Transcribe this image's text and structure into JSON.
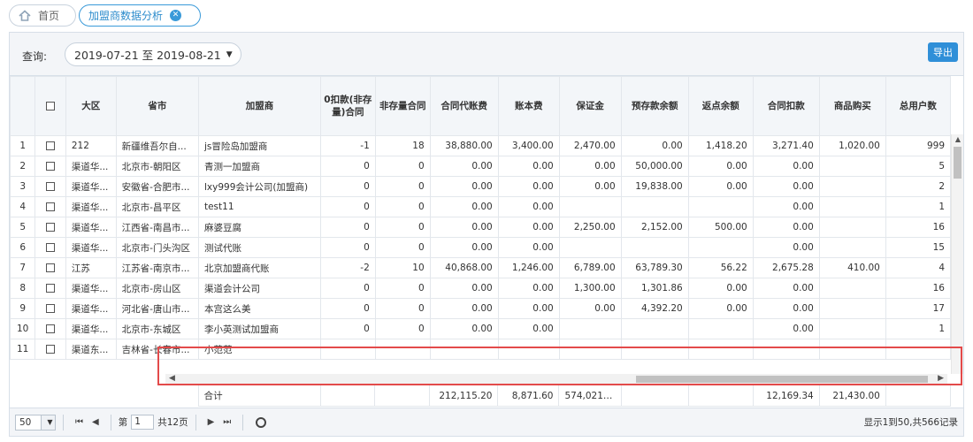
{
  "tabs": {
    "home_label": "首页",
    "active_label": "加盟商数据分析"
  },
  "query": {
    "label": "查询:",
    "date_range": "2019-07-21 至 2019-08-21",
    "export_label": "导出"
  },
  "table": {
    "headers": [
      "",
      "大区",
      "省市",
      "加盟商",
      "0扣款(非存量)合同",
      "非存量合同",
      "合同代账费",
      "账本费",
      "保证金",
      "预存款余额",
      "返点余额",
      "合同扣款",
      "商品购买",
      "总用户数"
    ],
    "rows": [
      [
        "1",
        "212",
        "新疆维吾尔自...",
        "js冒险岛加盟商",
        "-1",
        "18",
        "38,880.00",
        "3,400.00",
        "2,470.00",
        "0.00",
        "1,418.20",
        "3,271.40",
        "1,020.00",
        "999"
      ],
      [
        "2",
        "渠道华...",
        "北京市-朝阳区",
        "青测一加盟商",
        "0",
        "0",
        "0.00",
        "0.00",
        "0.00",
        "50,000.00",
        "0.00",
        "0.00",
        "",
        "5"
      ],
      [
        "3",
        "渠道华...",
        "安徽省-合肥市...",
        "lxy999会计公司(加盟商)",
        "0",
        "0",
        "0.00",
        "0.00",
        "0.00",
        "19,838.00",
        "0.00",
        "0.00",
        "",
        "2"
      ],
      [
        "4",
        "渠道华...",
        "北京市-昌平区",
        "test11",
        "0",
        "0",
        "0.00",
        "0.00",
        "",
        "",
        "",
        "0.00",
        "",
        "1"
      ],
      [
        "5",
        "渠道华...",
        "江西省-南昌市...",
        "麻婆豆腐",
        "0",
        "0",
        "0.00",
        "0.00",
        "2,250.00",
        "2,152.00",
        "500.00",
        "0.00",
        "",
        "16"
      ],
      [
        "6",
        "渠道华...",
        "北京市-门头沟区",
        "测试代账",
        "0",
        "0",
        "0.00",
        "0.00",
        "",
        "",
        "",
        "0.00",
        "",
        "15"
      ],
      [
        "7",
        "江苏",
        "江苏省-南京市...",
        "北京加盟商代账",
        "-2",
        "10",
        "40,868.00",
        "1,246.00",
        "6,789.00",
        "63,789.30",
        "56.22",
        "2,675.28",
        "410.00",
        "4"
      ],
      [
        "8",
        "渠道华...",
        "北京市-房山区",
        "渠道会计公司",
        "0",
        "0",
        "0.00",
        "0.00",
        "1,300.00",
        "1,301.86",
        "0.00",
        "0.00",
        "",
        "16"
      ],
      [
        "9",
        "渠道华...",
        "河北省-唐山市...",
        "本宫这么美",
        "0",
        "0",
        "0.00",
        "0.00",
        "0.00",
        "4,392.20",
        "0.00",
        "0.00",
        "",
        "17"
      ],
      [
        "10",
        "渠道华...",
        "北京市-东城区",
        "李小英测试加盟商",
        "0",
        "0",
        "0.00",
        "0.00",
        "",
        "",
        "",
        "0.00",
        "",
        "1"
      ],
      [
        "11",
        "渠道东...",
        "吉林省-长春市...",
        "小范范",
        "",
        "",
        "",
        "",
        "",
        "",
        "",
        "",
        "",
        ""
      ]
    ],
    "totals": [
      "合计",
      "",
      "",
      "212,115.20",
      "8,871.60",
      "574,021.00",
      "",
      "",
      "12,169.34",
      "21,430.00",
      ""
    ]
  },
  "pager": {
    "page_size": "50",
    "page_prefix": "第",
    "page_value": "1",
    "page_total": "共12页",
    "summary": "显示1到50,共566记录"
  },
  "colors": {
    "accent": "#2f8fd8",
    "highlight": "#e34a4a"
  }
}
